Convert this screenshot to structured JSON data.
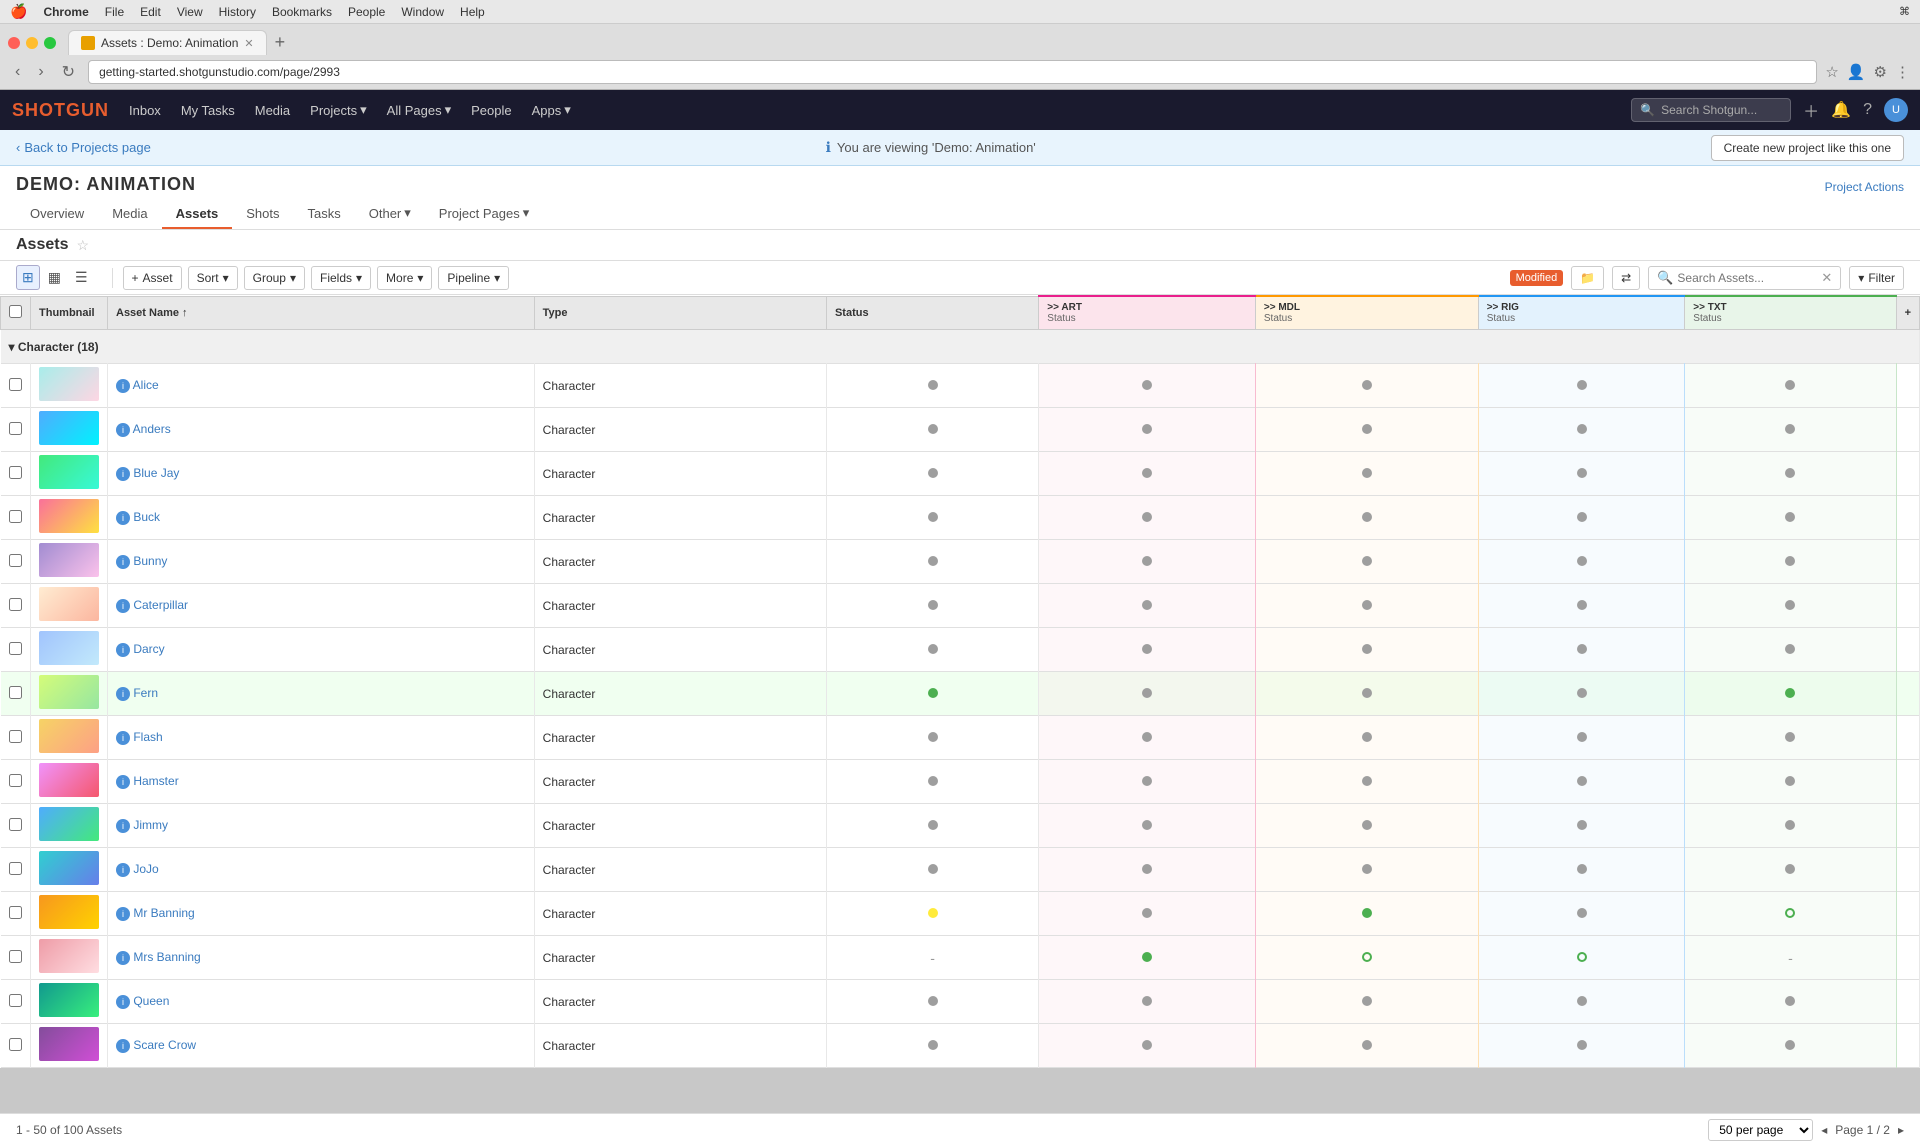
{
  "macbar": {
    "apple": "🍎",
    "menus": [
      "Chrome",
      "File",
      "Edit",
      "View",
      "History",
      "Bookmarks",
      "People",
      "Window",
      "Help"
    ],
    "right": "⌘"
  },
  "browser": {
    "tab_title": "Assets : Demo: Animation",
    "url": "getting-started.shotgunstudio.com/page/2993",
    "new_tab_label": "+"
  },
  "appnav": {
    "logo": "SHOTGUN",
    "items": [
      "Inbox",
      "My Tasks",
      "Media",
      "Projects",
      "All Pages",
      "People",
      "Apps"
    ],
    "search_placeholder": "Search Shotgun...",
    "dropdown_items": [
      "Projects",
      "All Pages",
      "Apps"
    ]
  },
  "banner": {
    "back_label": "Back to Projects page",
    "message": "You are viewing 'Demo: Animation'",
    "create_label": "Create new project like this one"
  },
  "project": {
    "title": "DEMO: ANIMATION",
    "tabs": [
      "Overview",
      "Media",
      "Assets",
      "Shots",
      "Tasks",
      "Other",
      "Project Pages"
    ],
    "active_tab": "Assets",
    "actions_label": "Project Actions"
  },
  "page": {
    "label": "Assets"
  },
  "toolbar": {
    "add_asset_label": "+ Asset",
    "sort_label": "Sort",
    "group_label": "Group",
    "fields_label": "Fields",
    "more_label": "More",
    "pipeline_label": "Pipeline",
    "modified_badge": "Modified",
    "search_placeholder": "Search Assets...",
    "filter_label": "Filter"
  },
  "table": {
    "columns": [
      {
        "id": "thumbnail",
        "label": "Thumbnail"
      },
      {
        "id": "asset_name",
        "label": "Asset Name"
      },
      {
        "id": "type",
        "label": "Type"
      },
      {
        "id": "status",
        "label": "Status"
      },
      {
        "id": "art_status",
        "label": "ART\nStatus",
        "step": "ART",
        "sub": "Status",
        "color": "pink"
      },
      {
        "id": "mdl_status",
        "label": "MDL\nStatus",
        "step": "MDL",
        "sub": "Status",
        "color": "orange"
      },
      {
        "id": "rig_status",
        "label": "RIG\nStatus",
        "step": "RIG",
        "sub": "Status",
        "color": "blue"
      },
      {
        "id": "txt_status",
        "label": "TXT\nStatus",
        "step": "TXT",
        "sub": "Status",
        "color": "green"
      }
    ],
    "group": {
      "label": "Character (18)"
    },
    "rows": [
      {
        "name": "Alice",
        "type": "Character",
        "status": "gray",
        "art": "gray",
        "mdl": "gray",
        "rig": "gray",
        "txt": "gray",
        "thumb": "alice"
      },
      {
        "name": "Anders",
        "type": "Character",
        "status": "gray",
        "art": "gray",
        "mdl": "gray",
        "rig": "gray",
        "txt": "gray",
        "thumb": "anders"
      },
      {
        "name": "Blue Jay",
        "type": "Character",
        "status": "gray",
        "art": "gray",
        "mdl": "gray",
        "rig": "gray",
        "txt": "gray",
        "thumb": "bluejay"
      },
      {
        "name": "Buck",
        "type": "Character",
        "status": "gray",
        "art": "gray",
        "mdl": "gray",
        "rig": "gray",
        "txt": "gray",
        "thumb": "buck"
      },
      {
        "name": "Bunny",
        "type": "Character",
        "status": "gray",
        "art": "gray",
        "mdl": "gray",
        "rig": "gray",
        "txt": "gray",
        "thumb": "bunny"
      },
      {
        "name": "Caterpillar",
        "type": "Character",
        "status": "gray",
        "art": "gray",
        "mdl": "gray",
        "rig": "gray",
        "txt": "gray",
        "thumb": "cat"
      },
      {
        "name": "Darcy",
        "type": "Character",
        "status": "gray",
        "art": "gray",
        "mdl": "gray",
        "rig": "gray",
        "txt": "gray",
        "thumb": "darcy"
      },
      {
        "name": "Fern",
        "type": "Character",
        "status": "green",
        "art": "gray",
        "mdl": "gray",
        "rig": "gray",
        "txt": "green",
        "thumb": "fern"
      },
      {
        "name": "Flash",
        "type": "Character",
        "status": "gray",
        "art": "gray",
        "mdl": "gray",
        "rig": "gray",
        "txt": "gray",
        "thumb": "flash"
      },
      {
        "name": "Hamster",
        "type": "Character",
        "status": "gray",
        "art": "gray",
        "mdl": "gray",
        "rig": "gray",
        "txt": "gray",
        "thumb": "hamster"
      },
      {
        "name": "Jimmy",
        "type": "Character",
        "status": "gray",
        "art": "gray",
        "mdl": "gray",
        "rig": "gray",
        "txt": "gray",
        "thumb": "jimmy"
      },
      {
        "name": "JoJo",
        "type": "Character",
        "status": "gray",
        "art": "gray",
        "mdl": "gray",
        "rig": "gray",
        "txt": "gray",
        "thumb": "jojo"
      },
      {
        "name": "Mr Banning",
        "type": "Character",
        "status": "yellow",
        "art": "gray",
        "mdl": "green",
        "rig": "gray",
        "txt": "circle",
        "thumb": "mrbanning"
      },
      {
        "name": "Mrs Banning",
        "type": "Character",
        "status": "dash",
        "art": "green",
        "mdl": "circle",
        "rig": "circle",
        "txt": "dash",
        "thumb": "mrsbanning"
      },
      {
        "name": "Queen",
        "type": "Character",
        "status": "gray",
        "art": "gray",
        "mdl": "gray",
        "rig": "gray",
        "txt": "gray",
        "thumb": "queen"
      },
      {
        "name": "Scare Crow",
        "type": "Character",
        "status": "gray",
        "art": "gray",
        "mdl": "gray",
        "rig": "gray",
        "txt": "gray",
        "thumb": "scarecrow"
      }
    ]
  },
  "footer": {
    "range_label": "1 - 50 of 100 Assets",
    "per_page_label": "50 per page",
    "page_label": "Page 1 / 2"
  }
}
